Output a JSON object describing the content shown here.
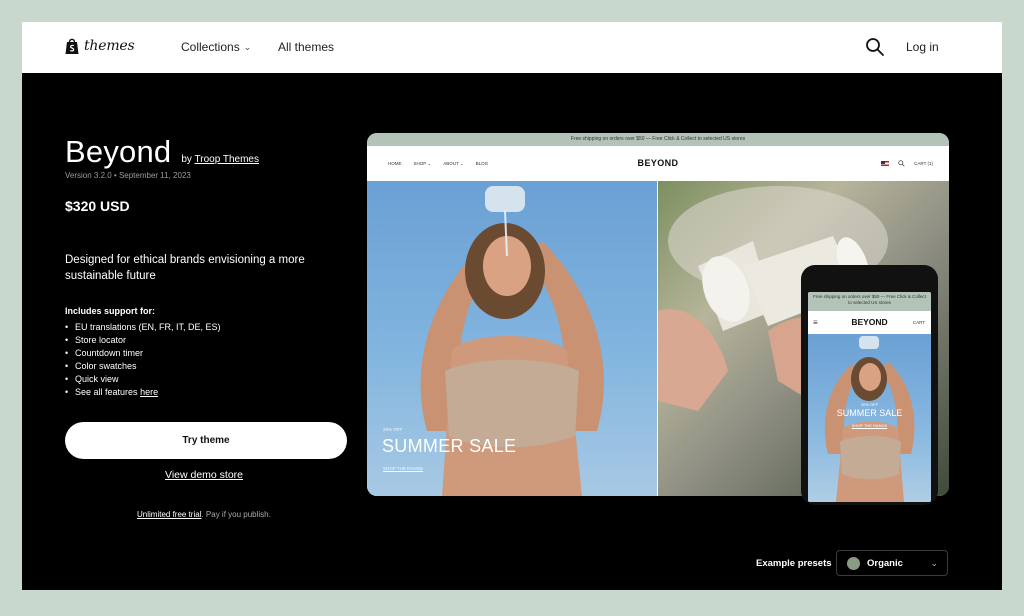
{
  "nav": {
    "brand": "themes",
    "collections": "Collections",
    "all_themes": "All themes",
    "login": "Log in"
  },
  "theme": {
    "name": "Beyond",
    "by_prefix": "by",
    "author": "Troop Themes",
    "version": "Version 3.2.0 • September 11, 2023",
    "price": "$320 USD",
    "tagline": "Designed for ethical brands envisioning a more sustainable future",
    "support_title": "Includes support for:",
    "features": [
      "EU translations (EN, FR, IT, DE, ES)",
      "Store locator",
      "Countdown timer",
      "Color swatches",
      "Quick view"
    ],
    "features_more_prefix": "See all features",
    "features_more_link": "here",
    "try_label": "Try theme",
    "demo_label": "View demo store",
    "trial_link": "Unlimited free trial",
    "trial_rest": ". Pay if you publish."
  },
  "preview": {
    "announcement": "Free shipping on orders over $50 — Free Click & Collect to selected US stores",
    "links": [
      "HOME",
      "SHOP ⌄",
      "ABOUT ⌄",
      "BLOG"
    ],
    "brand": "BEYOND",
    "cart": "CART (1)",
    "sale_tag": "20% OFF",
    "sale_title": "SUMMER SALE",
    "sale_cta": "SHOP THE RANGE"
  },
  "mobile": {
    "announcement": "Free shipping on orders over $50 — Free Click & Collect to selected US stores",
    "brand": "BEYOND",
    "cart": "CART",
    "sale_tag": "20% OFF",
    "sale_title": "SUMMER SALE",
    "sale_cta": "SHOP THE RANGE"
  },
  "presets": {
    "label": "Example presets",
    "selected": "Organic",
    "swatch_color": "#8a9a84"
  },
  "colors": {
    "page_bg": "#c9d8cd",
    "hero_bg": "#000000",
    "announcement_bg": "#b3c3b7"
  }
}
